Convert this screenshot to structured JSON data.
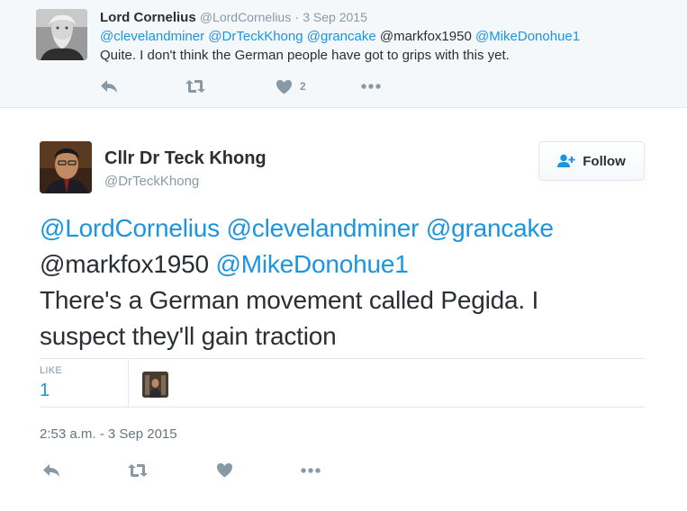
{
  "parent_tweet": {
    "name": "Lord Cornelius",
    "handle": "@LordCornelius",
    "separator": "·",
    "date": "3 Sep 2015",
    "mentions": [
      "@clevelandminer",
      "@DrTeckKhong",
      "@grancake",
      "@markfox1950",
      "@MikeDonohue1"
    ],
    "text": "Quite. I don't think the German people have got to grips with this yet.",
    "like_count": "2"
  },
  "main_tweet": {
    "name": "Cllr Dr Teck Khong",
    "handle": "@DrTeckKhong",
    "follow_label": "Follow",
    "mentions_line1": [
      "@LordCornelius",
      "@clevelandminer",
      "@grancake"
    ],
    "mentions_line2_plain": "@markfox1950",
    "mentions_line2_link": "@MikeDonohue1",
    "text_line1": "There's a German movement called Pegida. I",
    "text_line2": "suspect they'll gain traction",
    "like_label": "LIKE",
    "like_count": "1",
    "timestamp": "2:53 a.m. - 3 Sep 2015"
  },
  "colors": {
    "link": "#1b95e0",
    "icon": "#8899a6",
    "text": "#292f33",
    "muted": "#8899a6",
    "parent_bg": "#f5f8fa",
    "border": "#e1e8ed"
  },
  "icons": [
    "reply-icon",
    "retweet-icon",
    "heart-icon",
    "more-icon",
    "follow-user-plus-icon"
  ]
}
